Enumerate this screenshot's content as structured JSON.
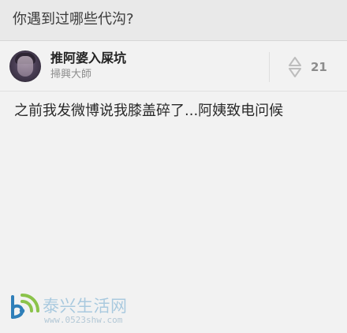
{
  "header": {
    "question_title": "你遇到过哪些代沟?"
  },
  "author": {
    "name": "推阿婆入屎坑",
    "title": "掃興大師",
    "avatar_icon": "user-avatar"
  },
  "vote": {
    "count": "21",
    "icon": "up-down-vote-icon"
  },
  "answer": {
    "text": "之前我发微博说我膝盖碎了...阿姨致电问候"
  },
  "watermark": {
    "site_name": "泰兴生活网",
    "site_url": "www.0523shw.com",
    "brand_colors": {
      "green": "#8bc34a",
      "blue": "#2f7fb9",
      "light_blue": "#a9c9de"
    }
  }
}
